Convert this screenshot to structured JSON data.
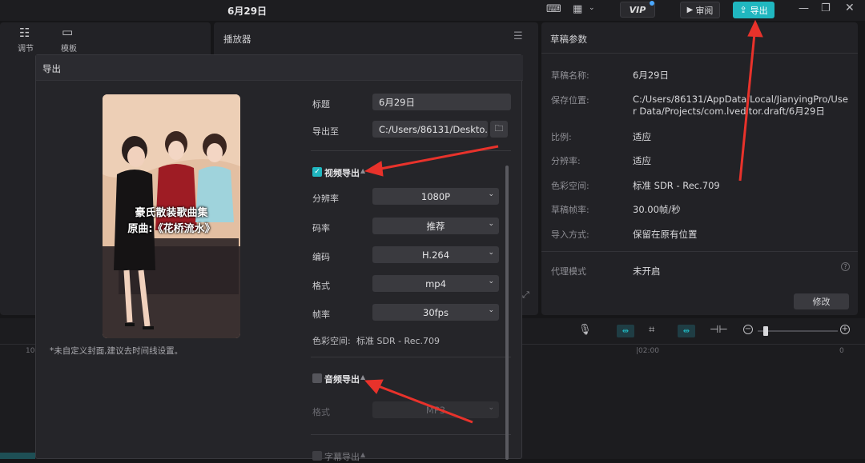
{
  "topbar": {
    "title": "6月29日",
    "vip": "VIP",
    "review_label": "审阅",
    "export_label": "导出"
  },
  "left_toolbar": {
    "adjust": "调节",
    "template": "模板"
  },
  "player": {
    "title": "播放器"
  },
  "draft": {
    "title": "草稿参数",
    "rows": [
      {
        "k": "草稿名称:",
        "v": "6月29日"
      },
      {
        "k": "保存位置:",
        "v": "C:/Users/86131/AppData/Local/JianyingPro/User Data/Projects/com.lveditor.draft/6月29日"
      },
      {
        "k": "比例:",
        "v": "适应"
      },
      {
        "k": "分辨率:",
        "v": "适应"
      },
      {
        "k": "色彩空间:",
        "v": "标准 SDR - Rec.709"
      },
      {
        "k": "草稿帧率:",
        "v": "30.00帧/秒"
      },
      {
        "k": "导入方式:",
        "v": "保留在原有位置"
      }
    ],
    "proxy_key": "代理模式",
    "proxy_val": "未开启",
    "modify": "修改"
  },
  "timeline": {
    "time_mark": "|02:00",
    "left_mark": "10",
    "right_mark": "0"
  },
  "export_dialog": {
    "header": "导出",
    "cover_text_line1": "豪氏散装歌曲集",
    "cover_text_line2": "原曲:《花桥流水》",
    "cover_hint": "*未自定义封面,建议去时间线设置。",
    "title_label": "标题",
    "title_value": "6月29日",
    "export_to_label": "导出至",
    "export_to_value": "C:/Users/86131/Deskto...",
    "video_section": "视频导出",
    "video_checked": true,
    "resolution_label": "分辨率",
    "resolution_value": "1080P",
    "bitrate_label": "码率",
    "bitrate_value": "推荐",
    "codec_label": "编码",
    "codec_value": "H.264",
    "format_label": "格式",
    "format_value": "mp4",
    "fps_label": "帧率",
    "fps_value": "30fps",
    "colorspace_label": "色彩空间:",
    "colorspace_value": "标准 SDR - Rec.709",
    "audio_section": "音频导出",
    "audio_checked": false,
    "audio_format_label": "格式",
    "audio_format_value": "MP3",
    "subtitle_section": "字幕导出"
  },
  "colors": {
    "accent": "#20b7c0",
    "annotation_arrow": "#e8322b"
  }
}
